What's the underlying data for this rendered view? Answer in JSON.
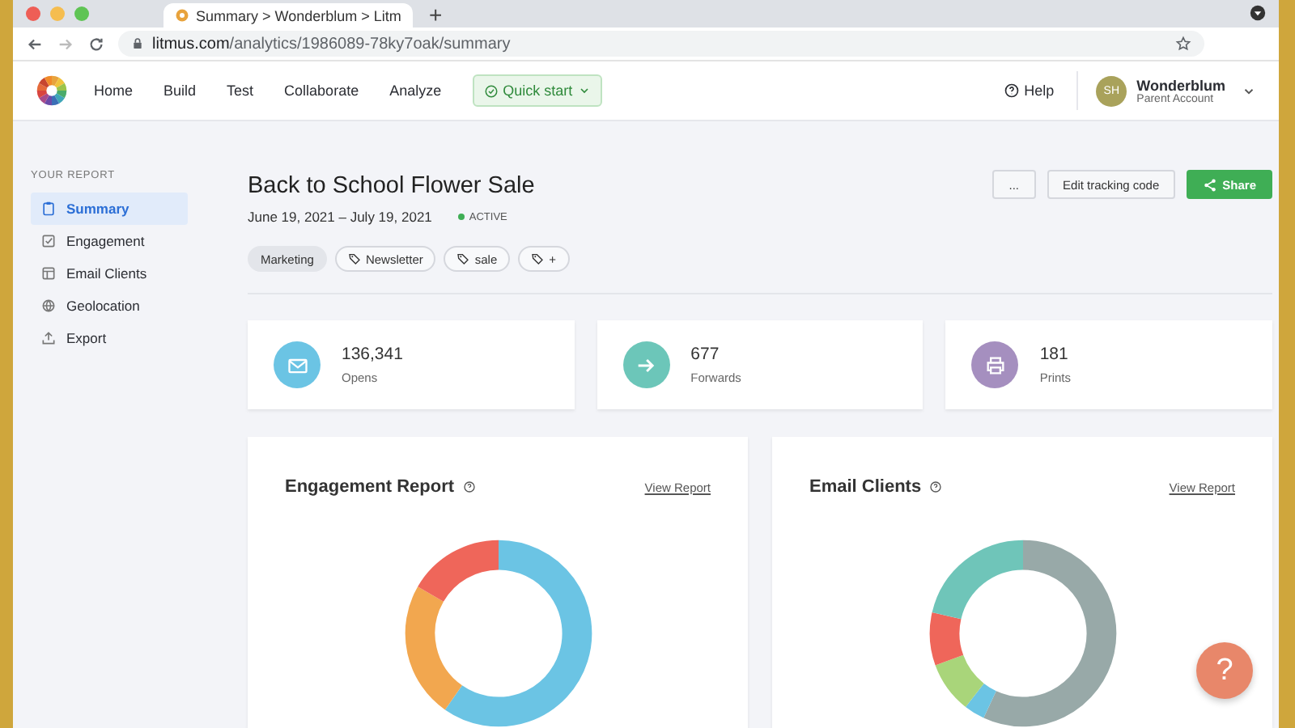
{
  "browser": {
    "tab_title": "Summary > Wonderblum > Litm",
    "new_tab": "+",
    "url_host": "litmus.com",
    "url_path": "/analytics/1986089-78ky7oak/summary"
  },
  "nav": {
    "items": [
      {
        "label": "Home"
      },
      {
        "label": "Build"
      },
      {
        "label": "Test"
      },
      {
        "label": "Collaborate"
      },
      {
        "label": "Analyze"
      }
    ],
    "quick_start": "Quick start",
    "help": "Help",
    "account": {
      "initials": "SH",
      "name": "Wonderblum",
      "subtitle": "Parent Account"
    }
  },
  "sidebar": {
    "heading": "YOUR REPORT",
    "items": [
      {
        "label": "Summary",
        "kind": "clipboard",
        "selected": true
      },
      {
        "label": "Engagement",
        "kind": "check",
        "selected": false
      },
      {
        "label": "Email Clients",
        "kind": "layout",
        "selected": false
      },
      {
        "label": "Geolocation",
        "kind": "globe",
        "selected": false
      },
      {
        "label": "Export",
        "kind": "upload",
        "selected": false
      }
    ]
  },
  "report": {
    "title": "Back to School Flower Sale",
    "date_range": "June 19, 2021 – July 19, 2021",
    "status": "ACTIVE",
    "tags": [
      {
        "kind": "category",
        "label": "Marketing"
      },
      {
        "kind": "tag",
        "label": "Newsletter"
      },
      {
        "kind": "tag",
        "label": "sale"
      },
      {
        "kind": "add",
        "label": "+"
      }
    ],
    "more_button": "...",
    "edit_button": "Edit tracking code",
    "share_button": "Share"
  },
  "stats": [
    {
      "value": "136,341",
      "label": "Opens",
      "kind": "mail",
      "color": "#6bc4e4"
    },
    {
      "value": "677",
      "label": "Forwards",
      "kind": "arrow",
      "color": "#6cc6b9"
    },
    {
      "value": "181",
      "label": "Prints",
      "kind": "printer",
      "color": "#a58fbf"
    }
  ],
  "charts": [
    {
      "title": "Engagement Report",
      "link": "View Report",
      "kind": "engagement"
    },
    {
      "title": "Email Clients",
      "link": "View Report",
      "kind": "clients"
    }
  ],
  "help_button": "?"
}
